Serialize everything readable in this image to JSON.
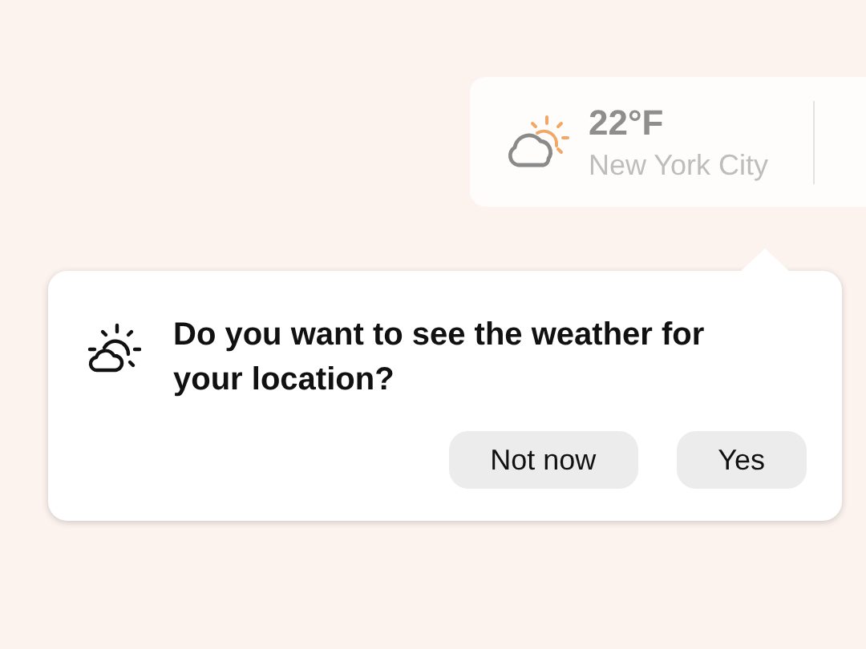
{
  "weather_widget": {
    "temperature": "22°F",
    "city": "New York City"
  },
  "popup": {
    "message": "Do you want to see the weather for your location?",
    "buttons": [
      {
        "label": "Not now"
      },
      {
        "label": "Yes"
      }
    ]
  }
}
